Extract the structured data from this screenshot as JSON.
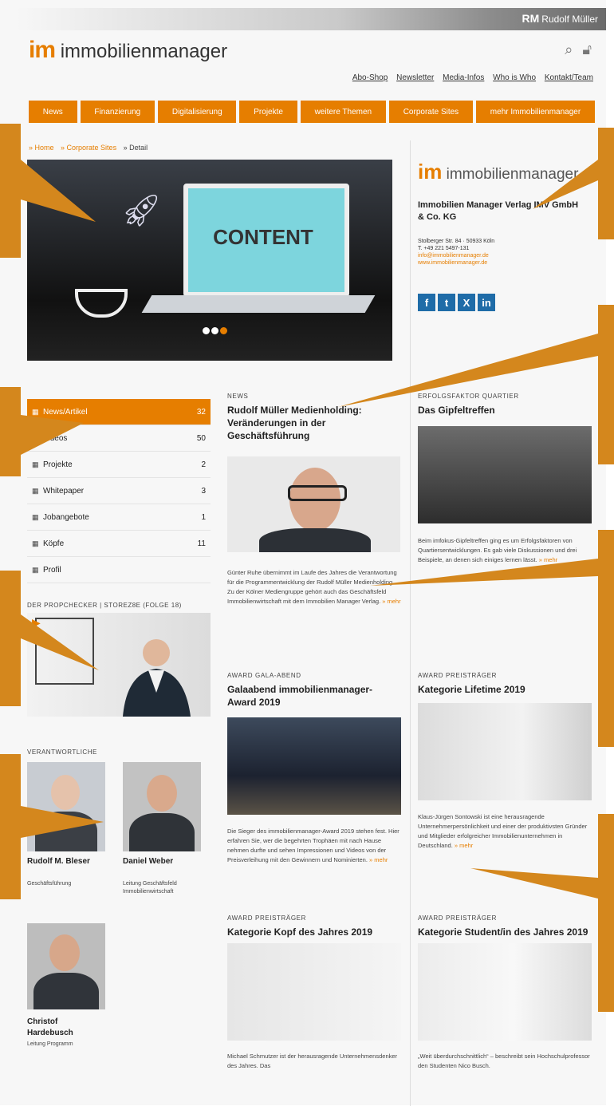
{
  "colors": {
    "accent": "#e67e00",
    "callout": "#d4871d",
    "social": "#1f6ca8"
  },
  "publisher": {
    "mark": "RM",
    "name": "Rudolf Müller"
  },
  "header": {
    "logo_mark": "im",
    "logo_text": "immobilienmanager",
    "icons": [
      "search-icon",
      "lock-icon"
    ],
    "top_links": [
      "Abo-Shop",
      "Newsletter",
      "Media-Infos",
      "Who is Who",
      "Kontakt/Team"
    ],
    "main_nav": [
      "News",
      "Finanzierung",
      "Digitalisierung",
      "Projekte",
      "weitere Themen",
      "Corporate Sites",
      "mehr Immobilienmanager"
    ]
  },
  "breadcrumb": [
    "» Home",
    "» Corporate Sites",
    "» Detail"
  ],
  "hero": {
    "screen_text": "CONTENT",
    "slides": 3,
    "active_slide": 3
  },
  "company_card": {
    "logo_mark": "im",
    "logo_text": "immobilienmanager",
    "name": "Immobilien Manager Verlag IMV GmbH & Co. KG",
    "address": "Stolberger Str. 84 · 50933 Köln",
    "phone": "T. +49 221 5497-131",
    "email": "info@immobilienmanager.de",
    "website": "www.immobilienmanager.de",
    "social": [
      "f",
      "t",
      "X",
      "in"
    ]
  },
  "sidebar": {
    "items": [
      {
        "label": "News/Artikel",
        "count": "32",
        "active": true
      },
      {
        "label": "Videos",
        "count": "50",
        "active": false
      },
      {
        "label": "Projekte",
        "count": "2",
        "active": false
      },
      {
        "label": "Whitepaper",
        "count": "3",
        "active": false
      },
      {
        "label": "Jobangebote",
        "count": "1",
        "active": false
      },
      {
        "label": "Köpfe",
        "count": "11",
        "active": false
      },
      {
        "label": "Profil",
        "count": "",
        "active": false
      }
    ],
    "video_heading": "DER PROPCHECKER | STOREZ8E (FOLGE 18)",
    "people_heading": "VERANTWORTLICHE",
    "people": [
      {
        "name": "Rudolf M. Bleser",
        "role": "Geschäftsführung"
      },
      {
        "name": "Daniel Weber",
        "role": "Leitung Geschäftsfeld Immobilienwirtschaft"
      },
      {
        "name": "Christof Hardebusch",
        "role": "Leitung Programm"
      }
    ]
  },
  "articles": [
    {
      "kicker": "NEWS",
      "title": "Rudolf Müller Medienholding: Veränderungen in der Geschäftsführung",
      "text": "Günter Ruhe übernimmt im Laufe des Jahres die Verantwortung für die Programmentwicklung der Rudolf Müller Medienholding. Zu der Kölner Mediengruppe gehört auch das Geschäftsfeld Immobilienwirtschaft mit dem Immobilien Manager Verlag.",
      "more": "» mehr"
    },
    {
      "kicker": "ERFOLGSFAKTOR QUARTIER",
      "title": "Das Gipfeltreffen",
      "text": "Beim imfokus-Gipfeltreffen ging es um Erfolgsfaktoren von Quartiersentwicklungen. Es gab viele Diskussionen und drei Beispiele, an denen sich einiges lernen lässt.",
      "more": "» mehr"
    },
    {
      "kicker": "AWARD GALA-ABEND",
      "title": "Galaabend immobilienmanager-Award 2019",
      "text": "Die Sieger des immobilienmanager-Award 2019 stehen fest. Hier erfahren Sie, wer die begehrten Trophäen mit nach Hause nehmen durfte und sehen Impressionen und Videos von der Preisverleihung mit den Gewinnern und Nominierten.",
      "more": "» mehr"
    },
    {
      "kicker": "AWARD PREISTRÄGER",
      "title": "Kategorie Lifetime 2019",
      "text": "Klaus-Jürgen Sontowski ist eine herausragende Unternehmerpersönlichkeit und einer der produktivsten Gründer und Mitglieder erfolgreicher Immobilienunternehmen in Deutschland.",
      "more": "» mehr"
    },
    {
      "kicker": "AWARD PREISTRÄGER",
      "title": "Kategorie Kopf des Jahres 2019",
      "text": "Michael Schmutzer ist der herausragende Unternehmensdenker des Jahres. Das",
      "more": ""
    },
    {
      "kicker": "AWARD PREISTRÄGER",
      "title": "Kategorie Student/in des Jahres 2019",
      "text": "„Weit überdurchschnittlich“ – beschreibt sein Hochschulprofessor den Studenten Nico Busch.",
      "more": ""
    }
  ]
}
